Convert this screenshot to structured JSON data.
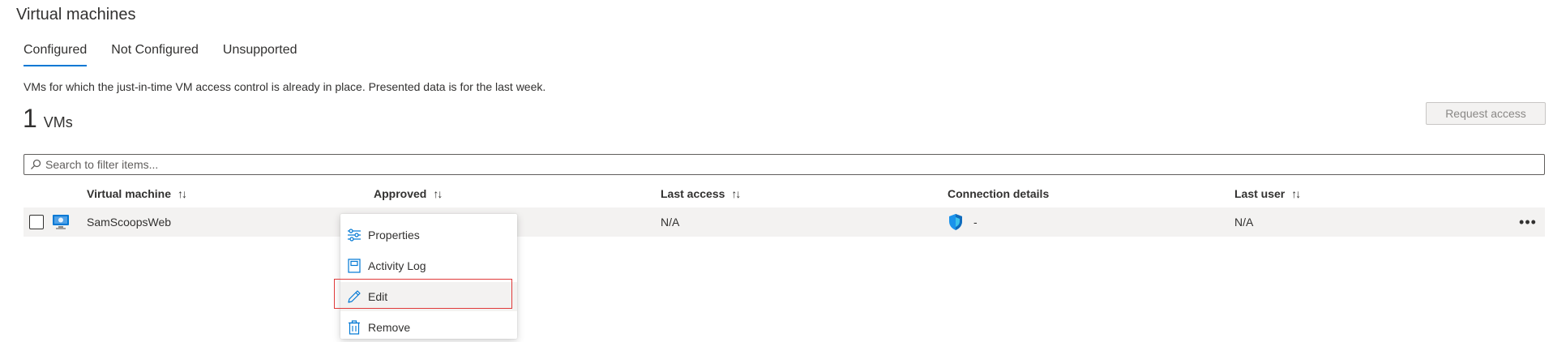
{
  "page": {
    "title": "Virtual machines"
  },
  "tabs": [
    {
      "label": "Configured",
      "active": true
    },
    {
      "label": "Not Configured",
      "active": false
    },
    {
      "label": "Unsupported",
      "active": false
    }
  ],
  "description": "VMs for which the just-in-time VM access control is already in place. Presented data is for the last week.",
  "summary": {
    "count": "1",
    "unit": "VMs"
  },
  "toolbar": {
    "request_access_label": "Request access"
  },
  "search": {
    "placeholder": "Search to filter items..."
  },
  "table": {
    "columns": [
      {
        "label": "Virtual machine",
        "sortable": true
      },
      {
        "label": "Approved",
        "sortable": true
      },
      {
        "label": "Last access",
        "sortable": true
      },
      {
        "label": "Connection details",
        "sortable": false
      },
      {
        "label": "Last user",
        "sortable": true
      }
    ],
    "sort_glyph": "↑↓",
    "rows": [
      {
        "virtual_machine": "SamScoopsWeb",
        "approved": "",
        "last_access": "N/A",
        "connection_details": "-",
        "last_user": "N/A",
        "more_glyph": "•••"
      }
    ]
  },
  "context_menu": {
    "items": [
      {
        "label": "Properties",
        "icon": "properties-icon"
      },
      {
        "label": "Activity Log",
        "icon": "activity-log-icon"
      },
      {
        "label": "Edit",
        "icon": "edit-icon",
        "highlighted": true
      },
      {
        "label": "Remove",
        "icon": "remove-icon"
      }
    ]
  },
  "colors": {
    "accent": "#0078d4",
    "row_background": "#f3f2f1",
    "highlight_border": "#e03a3a",
    "disabled_text": "#8a8886"
  }
}
